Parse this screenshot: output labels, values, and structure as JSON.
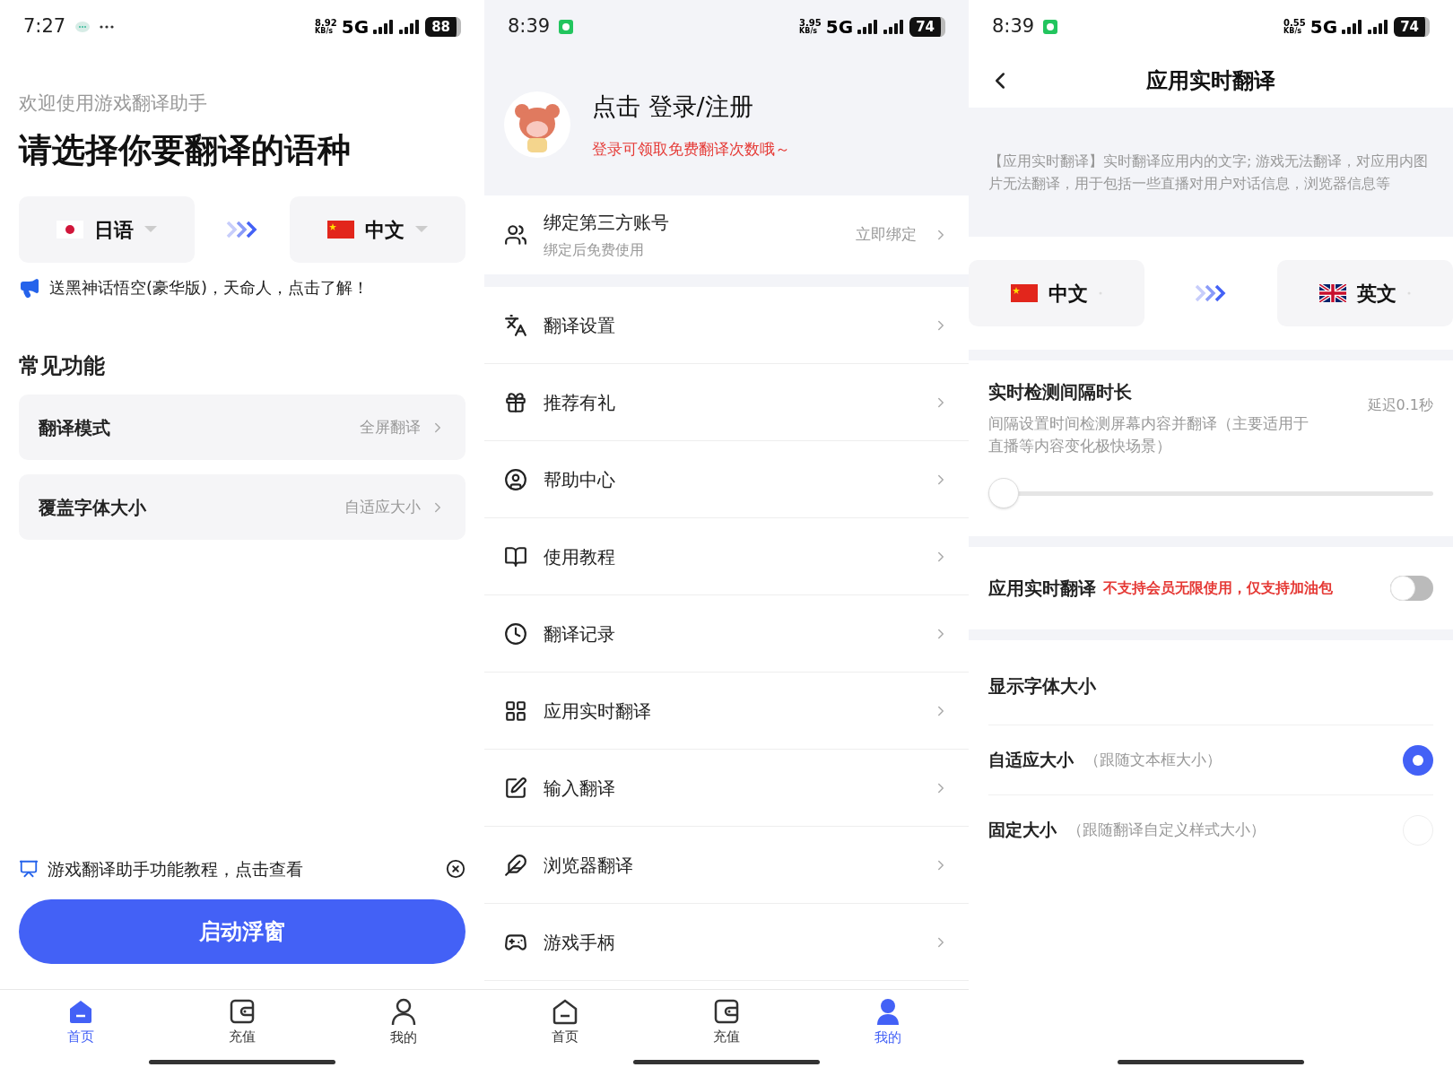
{
  "home_screen": {
    "status_bar": {
      "time": "7:27",
      "notifications": [
        {
          "kind": "chat"
        },
        {
          "kind": "more"
        }
      ],
      "speed": "8.92",
      "speed_unit": "KB/s",
      "network": "5G",
      "battery": "88"
    },
    "welcome": "欢迎使用游戏翻译助手",
    "title": "请选择你要翻译的语种",
    "languages": [
      {
        "label": "日语",
        "kind": "jp"
      },
      {
        "label": "中文",
        "kind": "cn"
      }
    ],
    "promo": "送黑神话悟空(豪华版)，天命人，点击了解！",
    "section_title": "常见功能",
    "settings": [
      {
        "label": "翻译模式",
        "value": "全屏翻译"
      },
      {
        "label": "覆盖字体大小",
        "value": "自适应大小"
      }
    ],
    "tutorial_banner": "游戏翻译助手功能教程，点击查看",
    "start_button": "启动浮窗",
    "bottom_nav": [
      {
        "label": "首页",
        "kind": "home",
        "selected": true
      },
      {
        "label": "充值",
        "kind": "wallet",
        "selected": false
      },
      {
        "label": "我的",
        "kind": "user",
        "selected": false
      }
    ]
  },
  "profile_screen": {
    "status_bar": {
      "time": "8:39",
      "notifications": [
        {
          "kind": "app"
        }
      ],
      "speed": "3.95",
      "speed_unit": "KB/s",
      "network": "5G",
      "battery": "74"
    },
    "login_title": "点击 登录/注册",
    "login_hint": "登录可领取免费翻译次数哦～",
    "bind_account": {
      "title": "绑定第三方账号",
      "subtitle": "绑定后免费使用",
      "action": "立即绑定"
    },
    "menu": [
      {
        "label": "翻译设置",
        "kind": "translate"
      },
      {
        "label": "推荐有礼",
        "kind": "gift"
      },
      {
        "label": "帮助中心",
        "kind": "help"
      },
      {
        "label": "使用教程",
        "kind": "book"
      },
      {
        "label": "翻译记录",
        "kind": "clock"
      },
      {
        "label": "应用实时翻译",
        "kind": "grid"
      },
      {
        "label": "输入翻译",
        "kind": "edit"
      },
      {
        "label": "浏览器翻译",
        "kind": "browser"
      },
      {
        "label": "游戏手柄",
        "kind": "gamepad"
      }
    ],
    "bottom_nav": [
      {
        "label": "首页",
        "kind": "home",
        "selected": false
      },
      {
        "label": "充值",
        "kind": "wallet",
        "selected": false
      },
      {
        "label": "我的",
        "kind": "user",
        "selected": true
      }
    ]
  },
  "realtime_screen": {
    "status_bar": {
      "time": "8:39",
      "notifications": [
        {
          "kind": "app"
        }
      ],
      "speed": "0.55",
      "speed_unit": "KB/s",
      "network": "5G",
      "battery": "74"
    },
    "title": "应用实时翻译",
    "info": "【应用实时翻译】实时翻译应用内的文字; 游戏无法翻译，对应用内图片无法翻译，用于包括一些直播对用户对话信息，浏览器信息等",
    "languages": [
      {
        "label": "中文",
        "kind": "cn"
      },
      {
        "label": "英文",
        "kind": "gb"
      }
    ],
    "interval": {
      "title": "实时检测间隔时长",
      "description": "间隔设置时间检测屏幕内容并翻译（主要适用于直播等内容变化极快场景）",
      "reading": "延迟0.1秒",
      "level": 0
    },
    "toggle": {
      "label": "应用实时翻译",
      "note": "不支持会员无限使用，仅支持加油包",
      "on": false
    },
    "font_size": {
      "title": "显示字体大小",
      "options": [
        {
          "label": "自适应大小",
          "hint": "（跟随文本框大小）",
          "selected": true
        },
        {
          "label": "固定大小",
          "hint": "（跟随翻译自定义样式大小）",
          "selected": false
        }
      ]
    }
  }
}
